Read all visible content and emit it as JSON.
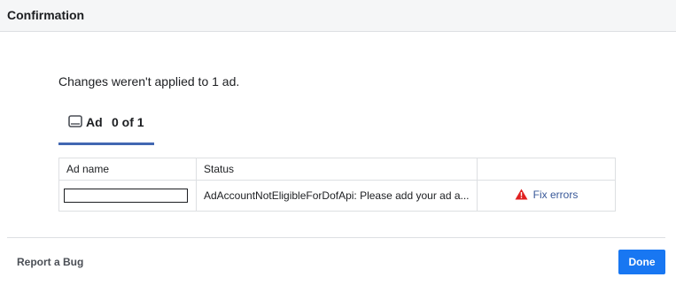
{
  "header": {
    "title": "Confirmation"
  },
  "message": "Changes weren't applied to 1 ad.",
  "tab": {
    "icon": "tablet-icon",
    "label": "Ad",
    "count": "0 of 1",
    "accent": "#4267b2"
  },
  "table": {
    "columns": [
      "Ad name",
      "Status",
      ""
    ],
    "rows": [
      {
        "ad_name": "",
        "status": "AdAccountNotEligibleForDofApi: Please add your ad a...",
        "action": {
          "icon": "warning-icon",
          "label": "Fix errors",
          "icon_color": "#e02020"
        }
      }
    ]
  },
  "footer": {
    "report_bug": "Report a Bug",
    "done": "Done",
    "done_color": "#1877f2"
  }
}
